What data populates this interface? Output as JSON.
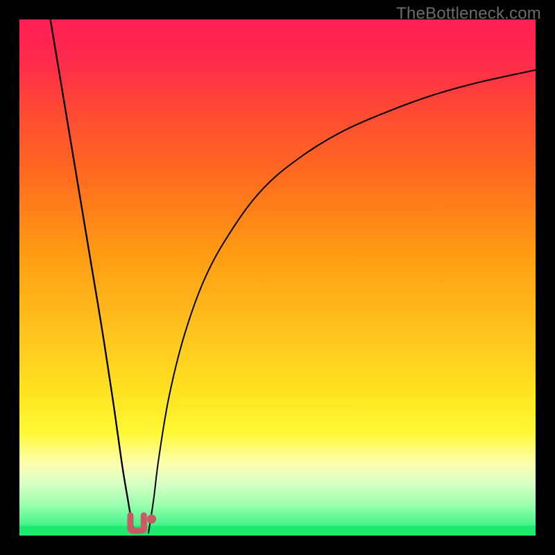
{
  "watermark": "TheBottleneck.com",
  "colors": {
    "frame": "#000000",
    "curve": "#000000",
    "marker": "#c95b66",
    "band_green": "#1fe86f"
  },
  "gradient_stops": [
    {
      "offset": 0.0,
      "color": "#ff1f55"
    },
    {
      "offset": 0.08,
      "color": "#ff2a4c"
    },
    {
      "offset": 0.18,
      "color": "#ff4a33"
    },
    {
      "offset": 0.3,
      "color": "#ff6a1f"
    },
    {
      "offset": 0.45,
      "color": "#ff9a12"
    },
    {
      "offset": 0.6,
      "color": "#ffc21e"
    },
    {
      "offset": 0.72,
      "color": "#ffe221"
    },
    {
      "offset": 0.8,
      "color": "#fff835"
    },
    {
      "offset": 0.86,
      "color": "#feffb0"
    },
    {
      "offset": 0.9,
      "color": "#d7ffc5"
    },
    {
      "offset": 0.94,
      "color": "#9bffb0"
    },
    {
      "offset": 0.975,
      "color": "#4ef590"
    },
    {
      "offset": 1.0,
      "color": "#14e86c"
    }
  ],
  "chart_data": {
    "type": "line",
    "title": "",
    "xlabel": "",
    "ylabel": "",
    "x_range": [
      0,
      100
    ],
    "y_range": [
      0,
      100
    ],
    "note": "Axes unlabeled in source image; values are normalized 0–100 to plot-area bounds.",
    "series": [
      {
        "name": "left_curve",
        "x": [
          6.0,
          8.0,
          10.0,
          12.0,
          14.0,
          16.0,
          18.0,
          19.0,
          20.0,
          21.0,
          21.7,
          22.3
        ],
        "y": [
          100.0,
          88.0,
          76.0,
          64.0,
          52.0,
          40.0,
          27.0,
          20.0,
          13.0,
          7.0,
          3.0,
          0.5
        ]
      },
      {
        "name": "right_curve",
        "x": [
          25.0,
          26.0,
          27.0,
          29.0,
          32.0,
          36.0,
          41.0,
          47.0,
          54.0,
          62.0,
          71.0,
          80.0,
          89.0,
          100.0
        ],
        "y": [
          0.5,
          7.0,
          15.0,
          27.0,
          39.0,
          50.0,
          59.0,
          67.0,
          73.0,
          78.0,
          82.0,
          85.3,
          87.8,
          90.2
        ]
      }
    ],
    "markers": [
      {
        "shape": "u",
        "name": "u-marker",
        "cx": 22.8,
        "cy": 2.4,
        "w": 2.6,
        "h": 3.0
      },
      {
        "shape": "dot",
        "name": "dot-marker",
        "cx": 25.6,
        "cy": 3.2,
        "r": 0.9
      }
    ]
  }
}
